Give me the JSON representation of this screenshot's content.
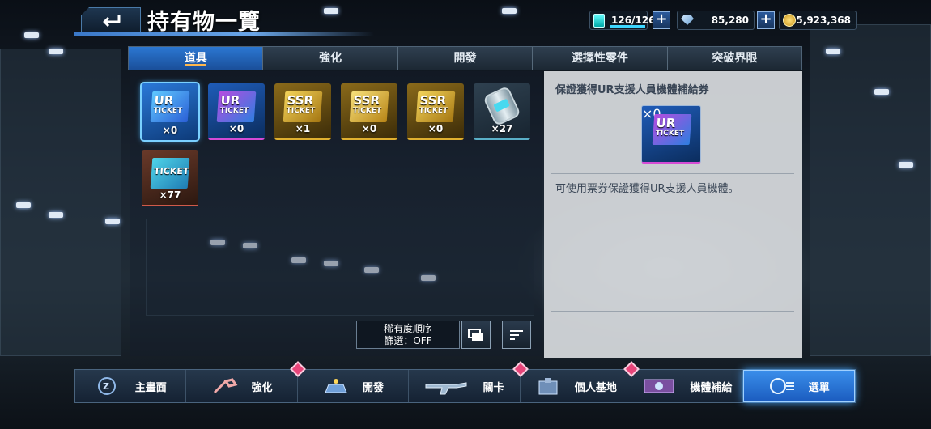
{
  "header": {
    "title": "持有物一覽",
    "stamina": "126/126",
    "gems": "85,280",
    "coins": "5,923,368"
  },
  "tabs": [
    "道具",
    "強化",
    "開發",
    "選擇性零件",
    "突破界限"
  ],
  "items": [
    {
      "tier": "UR",
      "sub": "TICKET",
      "qty": "×0",
      "icon": "ur-ticket-icon"
    },
    {
      "tier": "UR",
      "sub": "TICKET",
      "qty": "×0",
      "icon": "ur-mech-ticket-icon"
    },
    {
      "tier": "SSR",
      "sub": "TICKET",
      "qty": "×1",
      "icon": "ssr-ticket-icon"
    },
    {
      "tier": "SSR",
      "sub": "TICKET",
      "qty": "×0",
      "icon": "ssr-mech-ticket-icon"
    },
    {
      "tier": "SSR",
      "sub": "TICKET",
      "qty": "×0",
      "icon": "ssr-mech-ticket-icon"
    },
    {
      "tier": "",
      "sub": "",
      "qty": "×27",
      "icon": "canister-icon"
    },
    {
      "tier": "",
      "sub": "TICKET",
      "qty": "×77",
      "icon": "ticket-icon"
    }
  ],
  "sort": {
    "label": "稀有度順序",
    "filter": "篩選：OFF"
  },
  "detail": {
    "name": "保證獲得UR支援人員機體補給券",
    "qty": "×0",
    "tier": "UR",
    "sub": "TICKET",
    "description": "可使用票券保證獲得UR支援人員機體。"
  },
  "nav": [
    {
      "label": "主畫面",
      "icon": "home-icon"
    },
    {
      "label": "強化",
      "icon": "wrench-icon"
    },
    {
      "label": "開發",
      "icon": "develop-icon"
    },
    {
      "label": "關卡",
      "icon": "rifle-icon"
    },
    {
      "label": "個人基地",
      "icon": "base-icon"
    },
    {
      "label": "機體補給",
      "icon": "supply-icon"
    },
    {
      "label": "選單",
      "icon": "menu-icon"
    }
  ],
  "colors": {
    "accent": "#2b77d2",
    "badge": "#e8457a",
    "ur": "#3aa0ff",
    "ssr": "#d9a520"
  }
}
